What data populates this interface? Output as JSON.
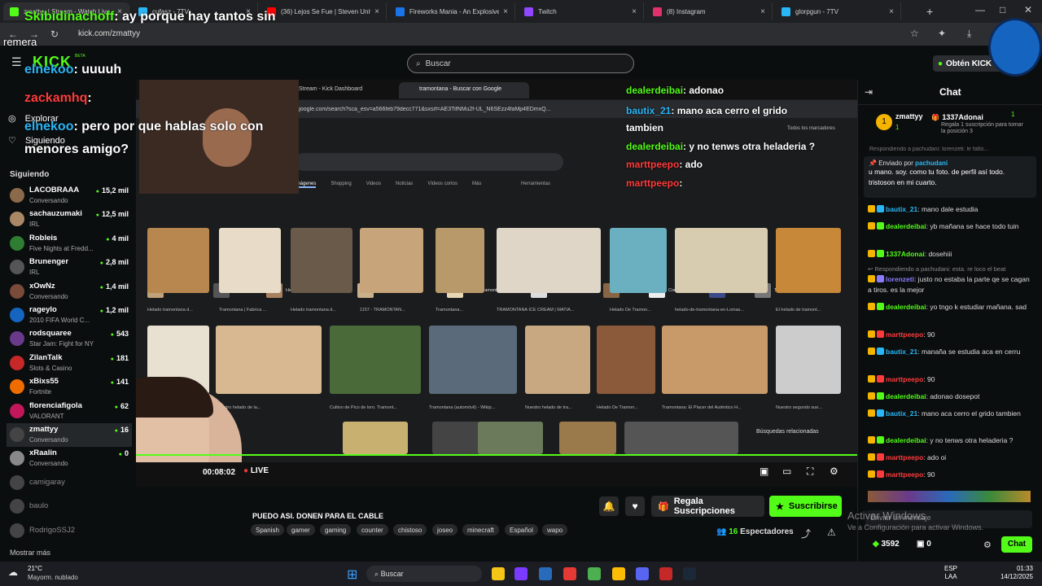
{
  "tabs": [
    {
      "title": "zmattyy | Stream - Watch Live...",
      "color": "#53fc18",
      "active": true
    },
    {
      "title": "cufasz - 7TV",
      "color": "#29b6f6"
    },
    {
      "title": "(36) Lejos Se Fue | Steven Univ...",
      "color": "#ff0000"
    },
    {
      "title": "Fireworks Mania - An Explosive...",
      "color": "#1b73e8"
    },
    {
      "title": "Twitch",
      "color": "#9146ff"
    },
    {
      "title": "(8) Instagram",
      "color": "#e1306c"
    },
    {
      "title": "glorpgun - 7TV",
      "color": "#29b6f6"
    }
  ],
  "url": "kick.com/zmattyy",
  "header": {
    "logo": "KICK",
    "beta": "BETA",
    "search_placeholder": "Buscar",
    "obtain_label": "Obtén KICK"
  },
  "sidebar": {
    "explore": "Explorar",
    "following_nav": "Siguiendo",
    "following_header": "Siguiendo",
    "show_more": "Mostrar más",
    "channels": [
      {
        "name": "LACOBRAAA",
        "sub": "Conversando",
        "viewers": "15,2 mil",
        "color": "#8a6a4a"
      },
      {
        "name": "sachauzumaki",
        "sub": "IRL",
        "viewers": "12,5 mil",
        "color": "#aa8866"
      },
      {
        "name": "Robleis",
        "sub": "Five Nights at Fredd...",
        "viewers": "4 mil",
        "color": "#2e7d32"
      },
      {
        "name": "Brunenger",
        "sub": "IRL",
        "viewers": "2,8 mil",
        "color": "#555"
      },
      {
        "name": "xOwNz",
        "sub": "Conversando",
        "viewers": "1,4 mil",
        "color": "#7a4a3a"
      },
      {
        "name": "rageylo",
        "sub": "2010 FIFA World C...",
        "viewers": "1,2 mil",
        "color": "#1565c0"
      },
      {
        "name": "rodsquaree",
        "sub": "Star Jam: Fight for NY",
        "viewers": "543",
        "color": "#6a3a8a"
      },
      {
        "name": "ZilanTalk",
        "sub": "Slots & Casino",
        "viewers": "181",
        "color": "#c62828"
      },
      {
        "name": "xBixs55",
        "sub": "Fortnite",
        "viewers": "141",
        "color": "#ef6c00"
      },
      {
        "name": "florenciafigola",
        "sub": "VALORANT",
        "viewers": "62",
        "color": "#c2185b"
      },
      {
        "name": "zmattyy",
        "sub": "Conversando",
        "viewers": "16",
        "color": "#444",
        "selected": true
      },
      {
        "name": "xRaalin",
        "sub": "Conversando",
        "viewers": "0",
        "color": "#888"
      },
      {
        "name": "camigaray",
        "offline": true
      },
      {
        "name": "baulo",
        "offline": true
      },
      {
        "name": "RodrigoSSJ2",
        "offline": true
      }
    ]
  },
  "overlay": {
    "top_user": "Skibidinachoff",
    "top_text": ": ay porque hay tantos sin",
    "top_word": "remera",
    "l1_user": "elnekoo",
    "l1_text": ": uuuuh",
    "l2_user": "zackamhq",
    "l2_text": ":",
    "l3_user": "elnekoo",
    "l3_text": ": pero por que hablas solo con",
    "l4_text": "menores amigo?"
  },
  "screen": {
    "tab1": "Stream - Kick Dashboard",
    "tab2": "tramontana - Buscar con Google",
    "gurl": "google.com/search?sca_esv=a566feb79decc771&sxsrf=AE3TifNMu2f-UL_N6SEzz4faMp4EDmxQ...",
    "search_tabs": [
      "Imágenes",
      "Shopping",
      "Videos",
      "Noticias",
      "Vídeos cortos",
      "Más"
    ],
    "tools": "Herramientas",
    "pills": [
      "Helado grido",
      "Coches",
      "Heladería tramontana",
      "Relleno tramontana",
      "Helado tramontana",
      "Crema tramontana",
      "Tortas",
      "Conaprole",
      "Car",
      "Tramontana"
    ],
    "row1_caps": [
      "Helado tramontana d...",
      "Tramontana | Fabrica ...",
      "Helado tramontana d...",
      "1157 - TRAMONTAN...",
      "Tramontana...",
      "TRAMONTANA ICE CREAM | MATIA...",
      "Helado De Tramon...",
      "helado-de-tramontana-en-Lomas...",
      "El helado de tramont..."
    ],
    "row2_caps": [
      "Helado tramontana",
      "Nuestro helado de la...",
      "Cultivo de Pico de loro. Tramont...",
      "Tramontana (automóvil) - Wikip...",
      "Nuestro helado de tra...",
      "Helado De Tramon...",
      "Tramontana: El Placer del Auténtico H...",
      "Nuestro segundo sue..."
    ],
    "related": "Búsquedas relacionadas",
    "chat": [
      {
        "user": "dealerdeibai",
        "text": ": adonao"
      },
      {
        "user": "bautix_21",
        "text": ": mano aca cerro el grido"
      },
      {
        "user": "",
        "text": "tambien"
      },
      {
        "user": "dealerdeibai",
        "text": ": y no tenws otra heladeria ?"
      },
      {
        "user": "marttpeepo",
        "text": ": ado"
      },
      {
        "user": "marttpeepo",
        "text": ":"
      }
    ],
    "bookmarks": "Todos los marcadores"
  },
  "player": {
    "time": "00:08:02",
    "live": "LIVE"
  },
  "info": {
    "title": "PUEDO ASI. DONEN PARA EL CABLE",
    "gift_label": "Regala Suscripciones",
    "subscribe_label": "Suscribirse",
    "viewers": "16",
    "viewers_label": "Espectadores",
    "tags": [
      "Spanish",
      "gamer",
      "gaming",
      "counter",
      "chistoso",
      "joseo",
      "minecraft",
      "Español",
      "wapo"
    ]
  },
  "chat": {
    "title": "Chat",
    "streamer": "zmattyy",
    "streamer_count": "1",
    "gifter": "1337Adonai",
    "gifter_count": "1",
    "gift_text": "Regala 1 suscripción para tomar la posición 3",
    "reply_hidden": "Respondiendo a pachudani: lorenzeti: le faltó...",
    "pinned_by_label": "Enviado por",
    "pinned_by": "pachudani",
    "pinned_text": "u mano. soy. como tu foto. de perfil así todo. tristoson en mi cuarto.",
    "messages": [
      {
        "user": "bautix_21",
        "color": "#29b6f6",
        "text": ": mano dale estudia"
      },
      {
        "user": "dealerdeibai",
        "color": "#53fc18",
        "text": ": yb mañana se hace todo tuin"
      },
      {
        "user": "1337Adonai",
        "color": "#53fc18",
        "text": ": dosehiii"
      },
      {
        "reply": "Respondiendo a pachudani: esta. re loco el beat"
      },
      {
        "user": "lorenzeti",
        "color": "#8a7cff",
        "text": ": justo no estaba la parte qe se cagan a tiros. es la mejor"
      },
      {
        "user": "dealerdeibai",
        "color": "#53fc18",
        "text": ": yo tngo k estudiar mañana. sad"
      },
      {
        "user": "marttpeepo",
        "color": "#ff3b3b",
        "text": ": 90"
      },
      {
        "user": "bautix_21",
        "color": "#29b6f6",
        "text": ": manaña se estudia aca en cerru"
      },
      {
        "user": "marttpeepo",
        "color": "#ff3b3b",
        "text": ": 90"
      },
      {
        "user": "dealerdeibai",
        "color": "#53fc18",
        "text": ": adonao dosepot"
      },
      {
        "user": "bautix_21",
        "color": "#29b6f6",
        "text": ": mano aca cerro el grido tambien"
      },
      {
        "user": "dealerdeibai",
        "color": "#53fc18",
        "text": ": y no tenws otra heladeria ?"
      },
      {
        "user": "marttpeepo",
        "color": "#ff3b3b",
        "text": ": ado oi"
      },
      {
        "user": "marttpeepo",
        "color": "#ff3b3b",
        "text": ": 90"
      }
    ],
    "input_placeholder": "Enviar un mensaje",
    "points": "3592",
    "count2": "0",
    "send_label": "Chat",
    "activate_title": "Activar Windows",
    "activate_sub": "Ve a Configuración para activar Windows."
  },
  "taskbar": {
    "temp": "21°C",
    "weather": "Mayorm. nublado",
    "search": "Buscar",
    "lang1": "ESP",
    "lang2": "LAA",
    "time": "01:33",
    "date": "14/12/2025"
  },
  "colors": {
    "kick_green": "#53fc18",
    "bg": "#0b0e0f"
  }
}
